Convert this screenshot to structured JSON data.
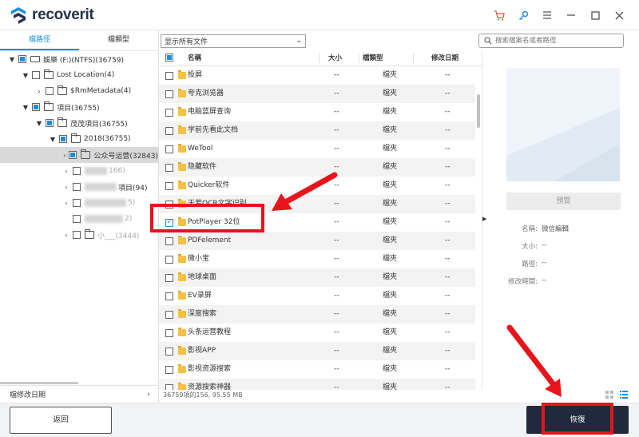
{
  "app": {
    "title": "recoverit"
  },
  "left_panel": {
    "tabs": [
      "檔路徑",
      "檔類型"
    ],
    "tree": [
      {
        "label": "娛樂 (F:)(NTFS)(36759)",
        "caret": "▼"
      },
      {
        "label": "Lost Location(4)",
        "caret": "▼"
      },
      {
        "label": "$RmMetadata(4)",
        "caret": "›"
      },
      {
        "label": "項目(36755)",
        "caret": "▼"
      },
      {
        "label": "茂茂項目(36755)",
        "caret": "▼"
      },
      {
        "label": "2018(36755)",
        "caret": "▼"
      },
      {
        "label": "公众号运营(32843)",
        "caret": "›"
      },
      {
        "label": "166)",
        "caret": "›"
      },
      {
        "label": "項目(94)",
        "caret": "›"
      },
      {
        "label": "5)",
        "caret": "›"
      },
      {
        "label": "2)",
        "caret": ""
      },
      {
        "label": "小___(3444)",
        "caret": "›"
      }
    ],
    "footer_label": "檔修改日期",
    "footer_arrow": "›"
  },
  "filter": {
    "selected": "显示所有文件"
  },
  "search": {
    "placeholder": "搜索檔案名或者路徑"
  },
  "table": {
    "columns": {
      "name": "名稱",
      "size": "大小",
      "type": "檔類型",
      "date": "修改日期"
    },
    "rows": [
      {
        "name": "投屏",
        "size": "--",
        "type": "檔夾",
        "date": "--"
      },
      {
        "name": "夸克浏览器",
        "size": "--",
        "type": "檔夾",
        "date": "--"
      },
      {
        "name": "电脑蓝屏查询",
        "size": "--",
        "type": "檔夾",
        "date": "--"
      },
      {
        "name": "学前先看此文档",
        "size": "--",
        "type": "檔夾",
        "date": "--"
      },
      {
        "name": "WeTool",
        "size": "--",
        "type": "檔夾",
        "date": "--"
      },
      {
        "name": "隐藏软件",
        "size": "--",
        "type": "檔夾",
        "date": "--"
      },
      {
        "name": "Quicker软件",
        "size": "--",
        "type": "檔夾",
        "date": "--"
      },
      {
        "name": "天若OCR文字识别",
        "size": "--",
        "type": "檔夾",
        "date": "--"
      },
      {
        "name": "PotPlayer 32位",
        "size": "--",
        "type": "檔夾",
        "date": "--",
        "checked": true
      },
      {
        "name": "PDFelement",
        "size": "--",
        "type": "檔夾",
        "date": "--"
      },
      {
        "name": "微小宝",
        "size": "--",
        "type": "檔夾",
        "date": "--"
      },
      {
        "name": "地球桌面",
        "size": "--",
        "type": "檔夾",
        "date": "--"
      },
      {
        "name": "EV录屏",
        "size": "--",
        "type": "檔夾",
        "date": "--"
      },
      {
        "name": "深度搜索",
        "size": "--",
        "type": "檔夾",
        "date": "--"
      },
      {
        "name": "头条运营教程",
        "size": "--",
        "type": "檔夾",
        "date": "--"
      },
      {
        "name": "影视APP",
        "size": "--",
        "type": "檔夾",
        "date": "--"
      },
      {
        "name": "影视资源搜索",
        "size": "--",
        "type": "檔夾",
        "date": "--"
      },
      {
        "name": "资源搜索神器",
        "size": "--",
        "type": "檔夾",
        "date": "--"
      }
    ],
    "status": "36759項的156, 95.55 MB"
  },
  "preview": {
    "button_label": "預覽",
    "info": [
      {
        "key": "名稱:",
        "value": "微信編輯"
      },
      {
        "key": "大小:",
        "value": "--"
      },
      {
        "key": "路徑:",
        "value": "--"
      },
      {
        "key": "修改時間:",
        "value": "--"
      }
    ]
  },
  "footer": {
    "back_label": "返回",
    "recover_label": "恢復"
  },
  "colors": {
    "accent": "#1a8ddb",
    "folder": "#f3c146",
    "recover_button": "#1f2b3d",
    "annotation_red": "#e8141b"
  }
}
